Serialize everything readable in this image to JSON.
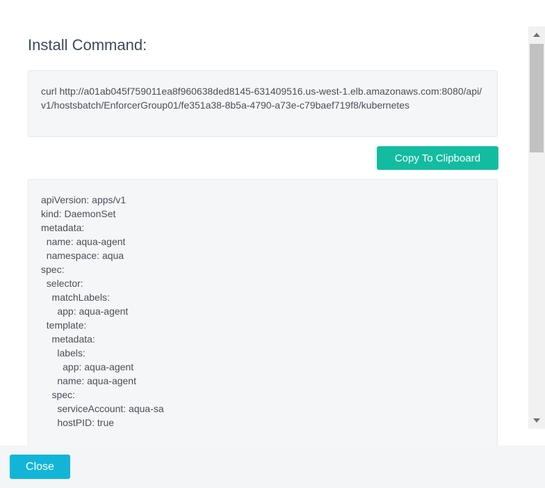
{
  "dialog": {
    "title": "Install Command:",
    "command": "curl http://a01ab045f759011ea8f960638ded8145-631409516.us-west-1.elb.amazonaws.com:8080/api/v1/hostsbatch/EnforcerGroup01/fe351a38-8b5a-4790-a73e-c79baef719f8/kubernetes",
    "copy_label": "Copy To Clipboard",
    "yaml_lines": [
      "apiVersion: apps/v1",
      "kind: DaemonSet",
      "metadata:",
      "  name: aqua-agent",
      "  namespace: aqua",
      "spec:",
      "  selector:",
      "    matchLabels:",
      "      app: aqua-agent",
      "  template:",
      "    metadata:",
      "      labels:",
      "        app: aqua-agent",
      "      name: aqua-agent",
      "    spec:",
      "      serviceAccount: aqua-sa",
      "      hostPID: true"
    ]
  },
  "footer": {
    "close_label": "Close"
  },
  "colors": {
    "copy_button": "#13bca0",
    "close_button": "#12b5d8",
    "title_text": "#3d4a5c",
    "code_background": "#f5f6f8"
  },
  "icons": {
    "scroll_up": "scroll-up-arrow-icon",
    "scroll_down": "scroll-down-arrow-icon"
  }
}
